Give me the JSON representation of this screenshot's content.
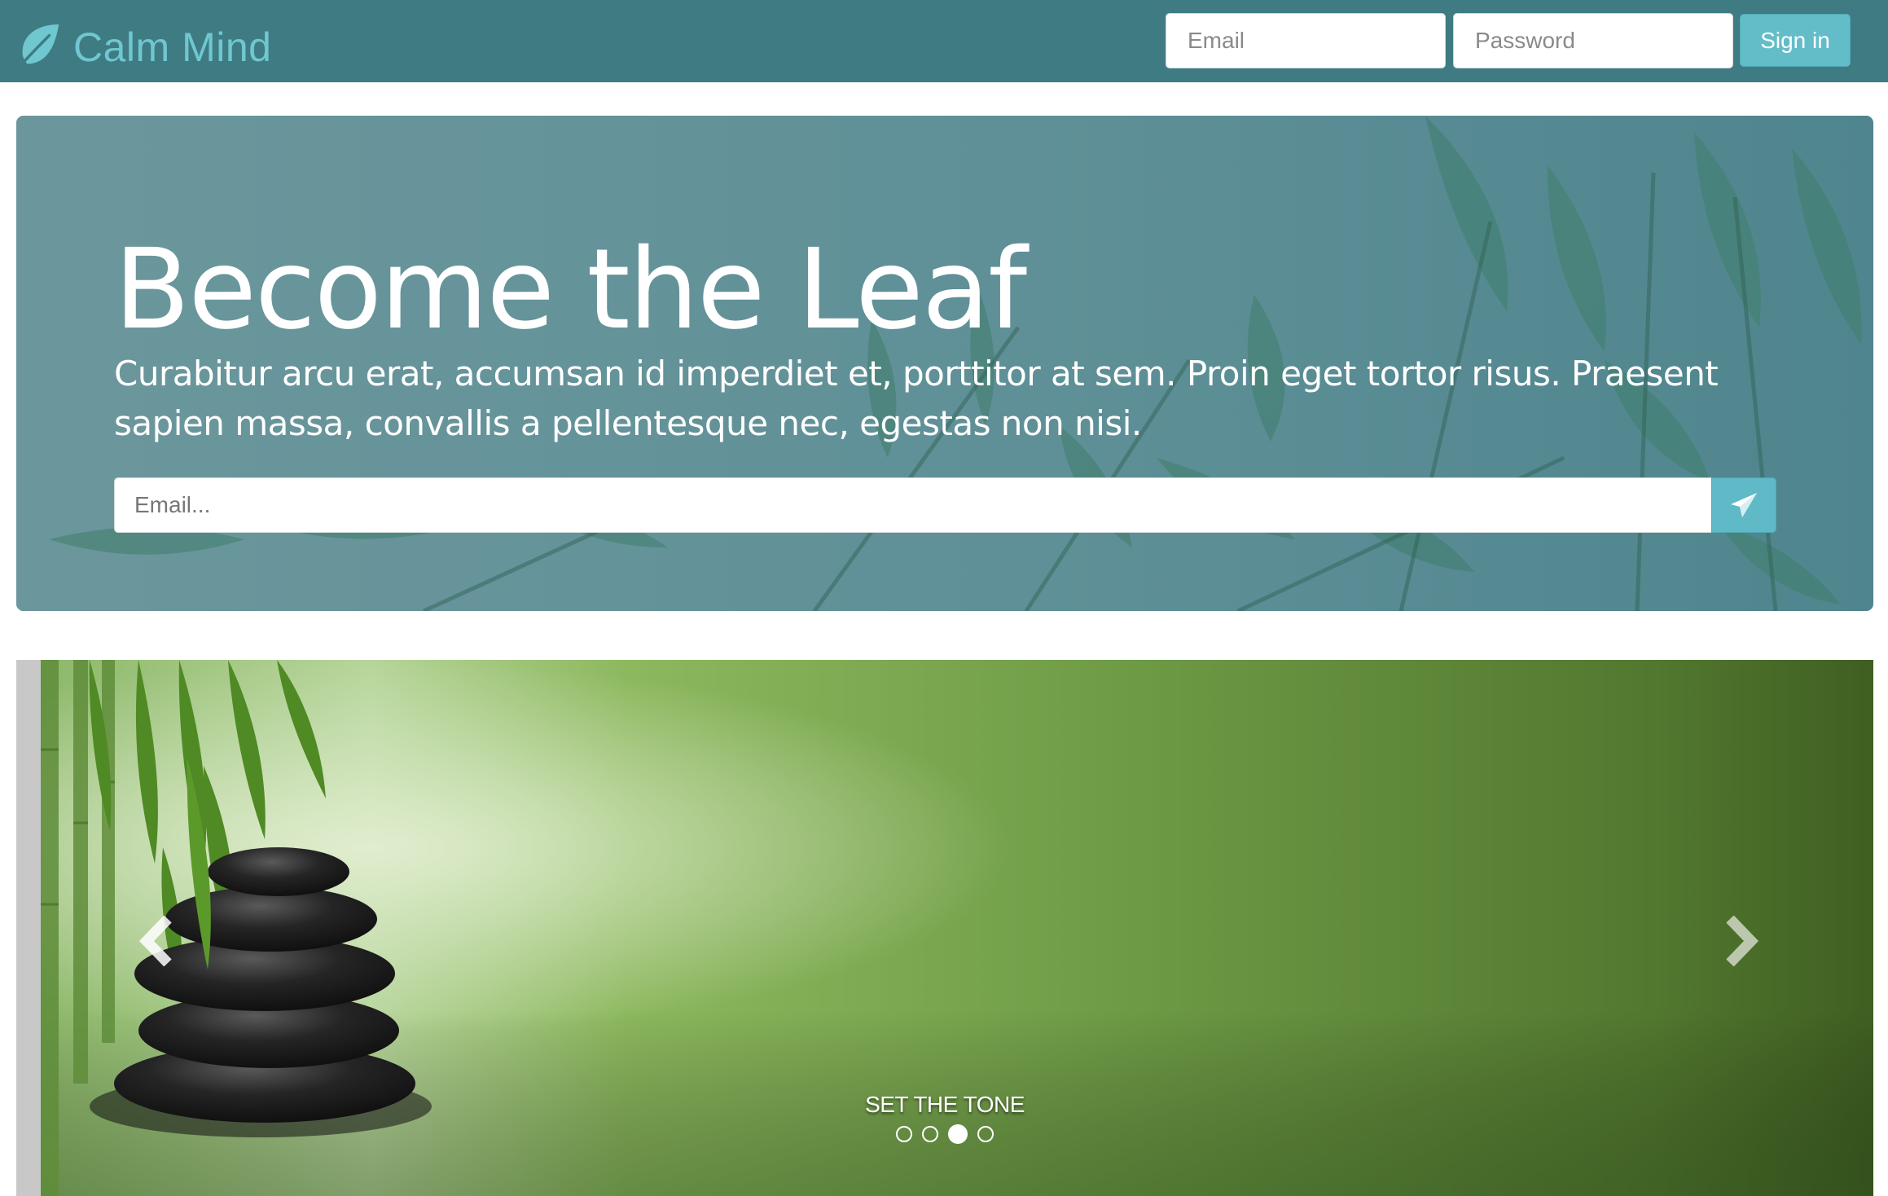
{
  "navbar": {
    "brand": "Calm Mind",
    "brand_icon": "leaf-icon",
    "email_placeholder": "Email",
    "password_placeholder": "Password",
    "signin_label": "Sign in",
    "colors": {
      "bar": "#3f7b83",
      "brand_text": "#6fc7d0",
      "button": "#63bdc9"
    }
  },
  "hero": {
    "title": "Become the Leaf",
    "text": "Curabitur arcu erat, accumsan id imperdiet et, porttitor at sem. Proin eget tortor risus. Praesent sapien massa, convallis a pellentesque nec, egestas non nisi.",
    "email_placeholder": "Email...",
    "send_icon": "paper-plane-icon"
  },
  "carousel": {
    "caption": "SET THE TONE",
    "prev_icon": "chevron-left-icon",
    "next_icon": "chevron-right-icon",
    "slide_count": 4,
    "active_index": 2
  }
}
